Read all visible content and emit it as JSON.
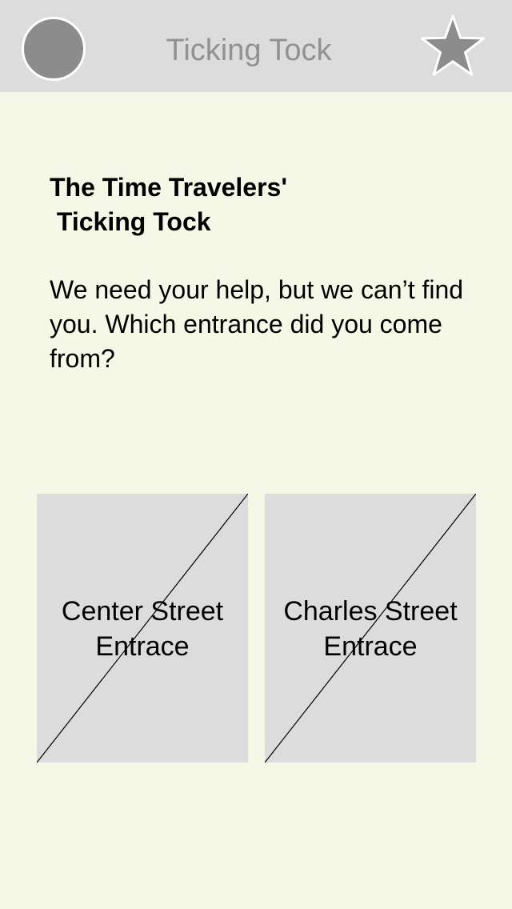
{
  "header": {
    "title": "Ticking Tock",
    "avatar_icon": "circle-avatar-icon",
    "favorite_icon": "star-icon"
  },
  "content": {
    "heading": "The Time Travelers'\n Ticking Tock",
    "prompt": "We need your help, but we can’t find you. Which entrance did you come from?"
  },
  "entrances": [
    {
      "label": "Center Street\nEntrace",
      "icon": "image-placeholder-icon"
    },
    {
      "label": "Charles Street\nEntrace",
      "icon": "image-placeholder-icon"
    }
  ],
  "colors": {
    "background": "#f5f8e6",
    "header_bg": "#dcdcdc",
    "icon_gray": "#8c8c8d",
    "tile_bg": "#dcdcdd"
  }
}
